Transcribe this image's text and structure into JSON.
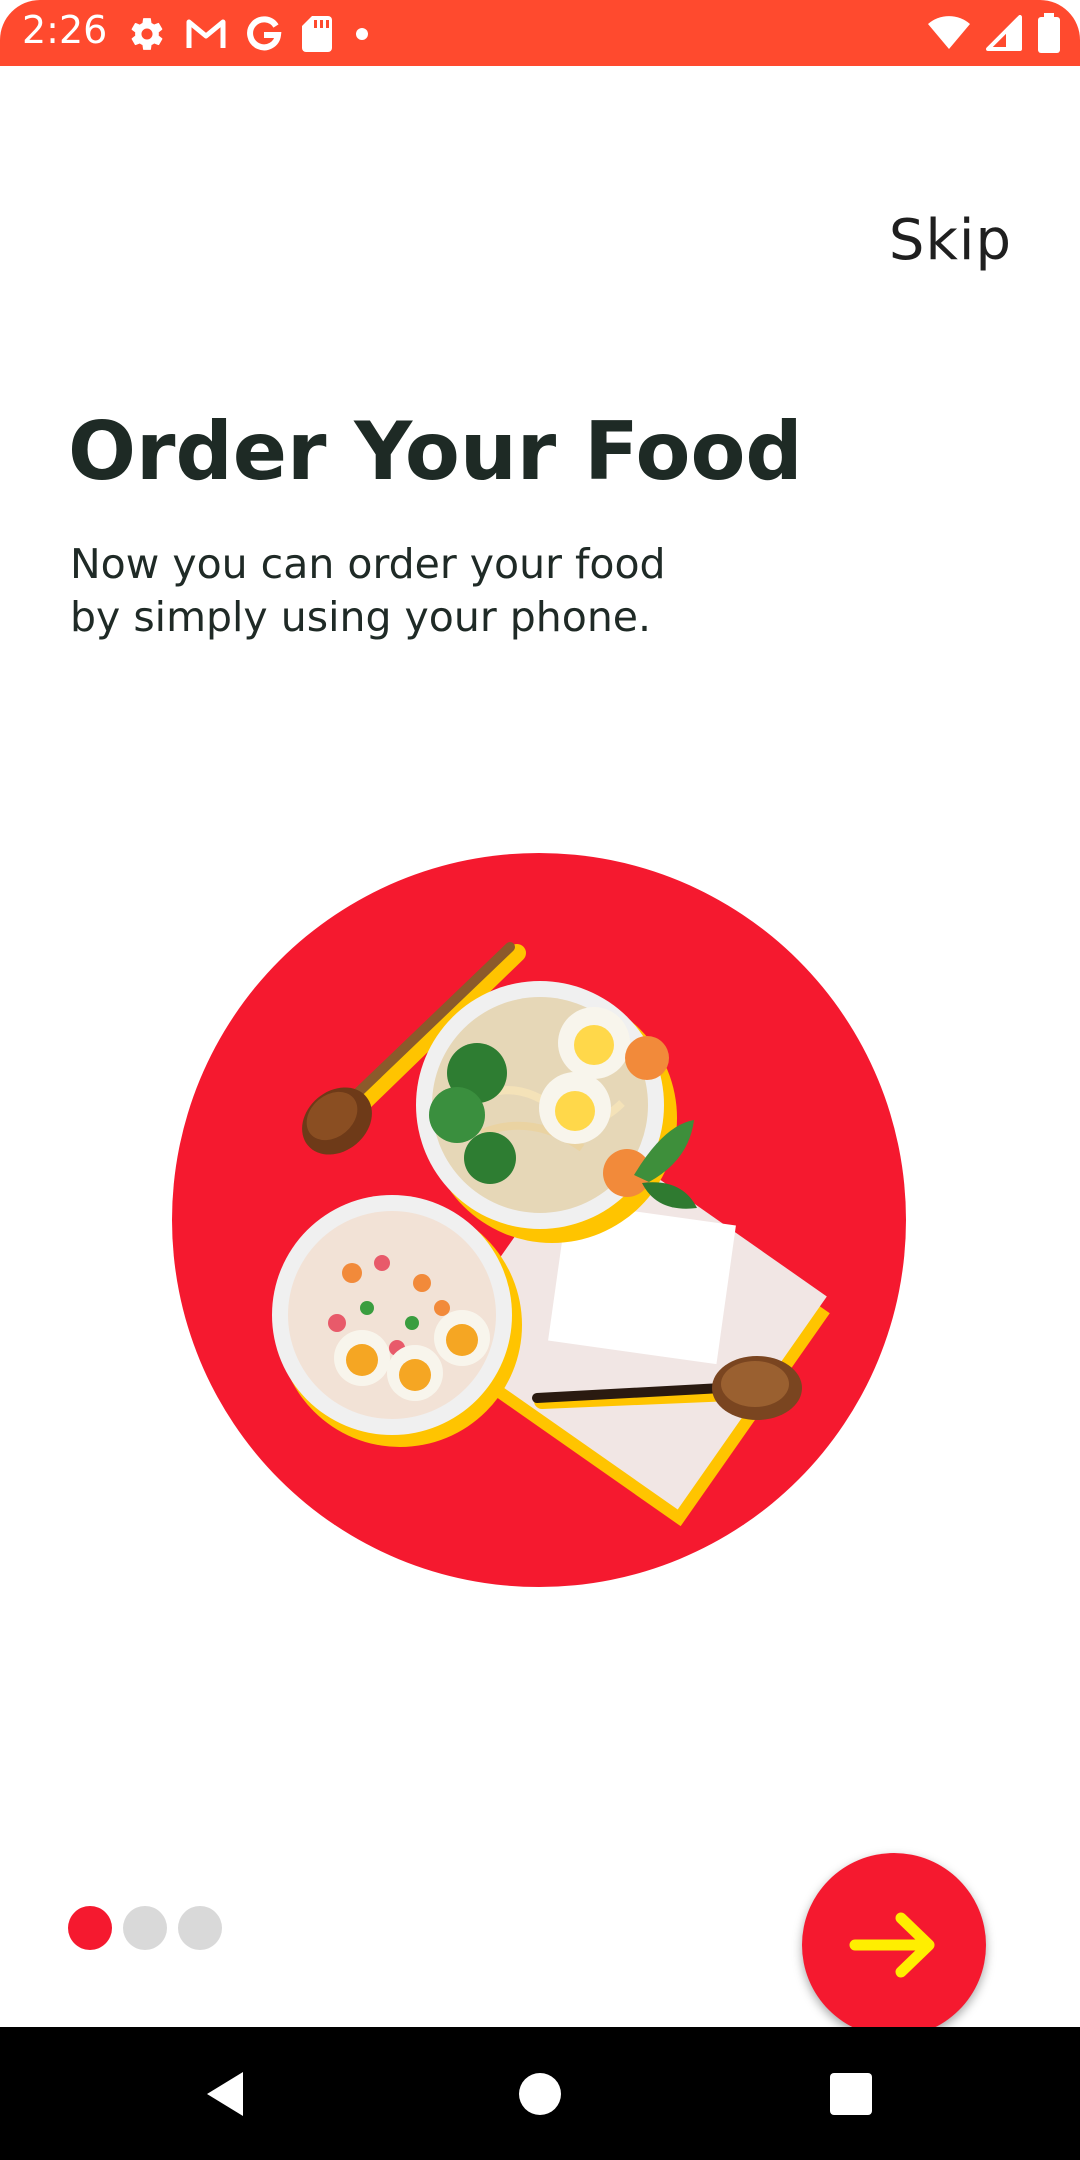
{
  "status_bar": {
    "time": "2:26",
    "left_icons": [
      "gear-icon",
      "gmail-icon",
      "google-icon",
      "sd-card-icon",
      "dot-icon"
    ],
    "right_icons": [
      "wifi-icon",
      "signal-icon",
      "battery-icon"
    ]
  },
  "onboarding": {
    "skip_label": "Skip",
    "title": "Order Your Food",
    "subtitle_line1": "Now you can order your food",
    "subtitle_line2": "by simply using your phone.",
    "page_count": 3,
    "active_page": 1,
    "next_icon": "arrow-right-icon"
  },
  "colors": {
    "status_bar": "#FF4A2E",
    "accent": "#F5192F",
    "arrow": "#FFEE00",
    "inactive_dot": "#D9D9D9"
  },
  "nav_bar": {
    "buttons": [
      "back-icon",
      "home-icon",
      "recents-icon"
    ]
  }
}
